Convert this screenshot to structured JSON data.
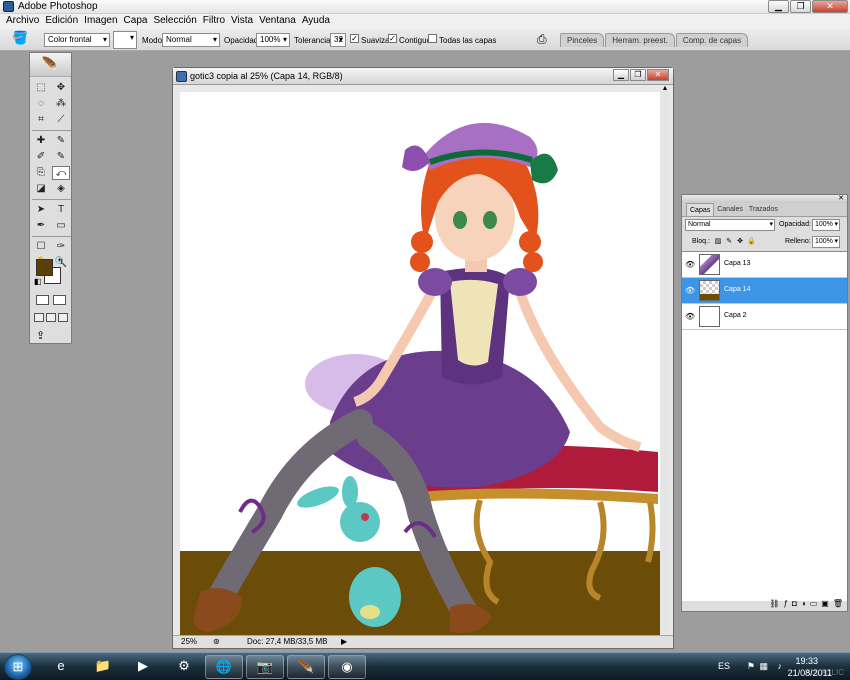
{
  "app": {
    "title": "Adobe Photoshop",
    "window_buttons": [
      "▁",
      "❐",
      "✕"
    ]
  },
  "menu": [
    "Archivo",
    "Edición",
    "Imagen",
    "Capa",
    "Selección",
    "Filtro",
    "Vista",
    "Ventana",
    "Ayuda"
  ],
  "options": {
    "fill_source": "Color frontal",
    "mode_label": "Modo:",
    "mode_value": "Normal",
    "opacity_label": "Opacidad:",
    "opacity_value": "100%",
    "tolerance_label": "Tolerancia:",
    "tolerance_value": "32",
    "antialias_label": "Suavizar",
    "antialias_checked": "✓",
    "contiguous_label": "Contiguo",
    "contiguous_checked": "✓",
    "all_layers_label": "Todas las capas",
    "well_tabs": [
      "Pinceles",
      "Herram. preest.",
      "Comp. de capas"
    ]
  },
  "tools": {
    "logo": "🪶",
    "icons": [
      "⬚",
      "✥",
      "◌",
      "⁂",
      "⌗",
      "⟋",
      "✚",
      "✎",
      "✐",
      "✎",
      "⎘",
      "⤺",
      "◪",
      "◈",
      "◐",
      "◎",
      "➤",
      "T",
      "✒",
      "▭",
      "☐",
      "✑",
      "✋",
      "🔍"
    ],
    "foreground_color": "#5a3f07",
    "background_color": "#ffffff",
    "swap": "↰",
    "default": "◧",
    "jump": "⇪"
  },
  "document": {
    "title": "gotic3 copia al 25% (Capa 14, RGB/8)",
    "zoom": "25%",
    "doc_size": "Doc: 27,4 MB/33,5 MB",
    "scroll_up": "▲",
    "scroll_down": "▼",
    "nav_arrow": "▶"
  },
  "layers": {
    "tabs": [
      "Capas",
      "Canales",
      "Trazados"
    ],
    "blend_mode": "Normal",
    "opacity_label": "Opacidad:",
    "opacity_value": "100%",
    "lock_label": "Bloq.:",
    "lock_icons": [
      "▨",
      "✎",
      "✥",
      "🔒"
    ],
    "fill_label": "Relleno:",
    "fill_value": "100%",
    "items": [
      {
        "name": "Capa 13",
        "visible": "👁"
      },
      {
        "name": "Capa 14",
        "visible": "👁"
      },
      {
        "name": "Capa 2",
        "visible": "👁"
      }
    ],
    "footer_icons": [
      "⛓",
      "ƒ",
      "◘",
      "◑",
      "▭",
      "▣",
      "🗑"
    ]
  },
  "taskbar": {
    "start": "⊞",
    "apps": [
      "e",
      "📁",
      "▶",
      "⚙",
      "🌐",
      "📷",
      "🪶",
      "◉"
    ],
    "language": "ES",
    "time": "19:33",
    "date": "21/08/2011",
    "watermark": "AULACLIC"
  }
}
